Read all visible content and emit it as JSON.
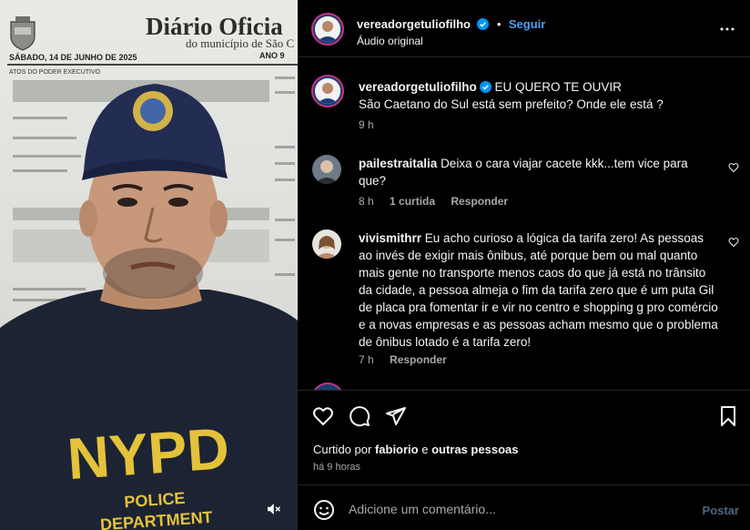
{
  "video": {
    "document_title": "Diário Oficia",
    "document_subtitle": "do município de São C",
    "document_date": "SÁBADO, 14 DE JUNHO DE 2025",
    "document_year": "ANO 9",
    "section": "ATOS DO PODER EXECUTIVO",
    "mute_icon": "muted-speaker-icon"
  },
  "header": {
    "username": "vereadorgetuliofilho",
    "dot": "•",
    "follow_label": "Seguir",
    "audio_label": "Áudio original",
    "more_icon": "more-horizontal-icon"
  },
  "caption": {
    "username": "vereadorgetuliofilho",
    "text_line1": "EU QUERO TE OUVIR",
    "text_line2": "São Caetano do Sul está sem prefeito? Onde ele está ?",
    "time": "9 h"
  },
  "comments": [
    {
      "username": "pailestraitalia",
      "text": "Deixa o cara viajar cacete kkk...tem vice para que?",
      "time": "8 h",
      "likes": "1 curtida",
      "reply": "Responder"
    },
    {
      "username": "vivismithrr",
      "text": "Eu acho curioso a lógica da tarifa zero! As pessoas ao invés de exigir mais ônibus, até porque bem ou mal quanto mais gente no transporte menos caos do que já está no trânsito da cidade, a pessoa almeja o fim da tarifa zero que é um puta Gil de placa pra fomentar ir e vir no centro e shopping g pro comércio e a novas empresas e as pessoas acham mesmo que o problema de ônibus lotado é a tarifa zero!",
      "time": "7 h",
      "reply": "Responder"
    }
  ],
  "likes": {
    "prefix": "Curtido por",
    "user": "fabiorio",
    "conj": "e",
    "others": "outras pessoas"
  },
  "posted": "há 9 horas",
  "composer": {
    "placeholder": "Adicione um comentário...",
    "post_label": "Postar"
  },
  "colors": {
    "accent": "#4c9ff5",
    "muted": "#a8a8a8",
    "background": "#000000"
  }
}
